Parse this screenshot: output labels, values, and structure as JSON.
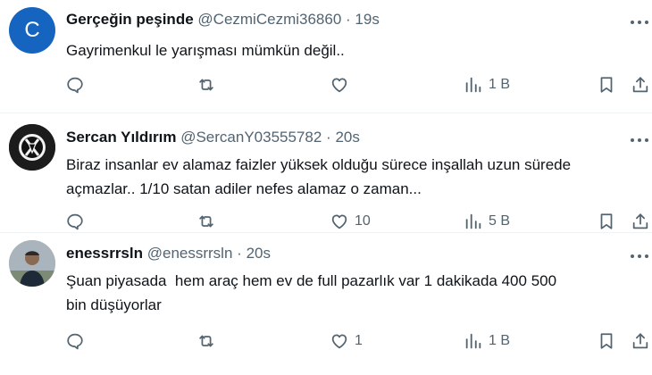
{
  "tweets": [
    {
      "name": "Gerçeğin peşinde",
      "handle": "@CezmiCezmi36860",
      "dot": "·",
      "time": "19s",
      "avatar_letter": "C",
      "avatar_color": "#1565c0",
      "text": "Gayrimenkul le yarışması mümkün değil..",
      "likes": "",
      "views": "1 B"
    },
    {
      "name": "Sercan Yıldırım",
      "handle": "@SercanY03555782",
      "dot": "·",
      "time": "20s",
      "avatar_letter": "",
      "avatar_color": "#1a1a1a",
      "text": "Biraz insanlar ev alamaz faizler yüksek olduğu sürece inşallah uzun sürede\naçmazlar.. 1/10 satan adiler nefes alamaz o zaman...",
      "likes": "10",
      "views": "5 B"
    },
    {
      "name": "enessrrsln",
      "handle": "@enessrrsln",
      "dot": "·",
      "time": "20s",
      "avatar_letter": "",
      "avatar_color": "#7a8a96",
      "text": "Şuan piyasada  hem araç hem ev de full pazarlık var 1 dakikada 400 500\nbin düşüyorlar",
      "likes": "1",
      "views": "1 B"
    }
  ],
  "icons": {
    "reply": "reply-icon",
    "retweet": "retweet-icon",
    "like": "heart-icon",
    "views": "views-icon",
    "bookmark": "bookmark-icon",
    "share": "share-icon",
    "more": "more-icon"
  },
  "colors": {
    "text": "#0f1419",
    "secondary": "#536471",
    "separator": "#eff3f4"
  }
}
